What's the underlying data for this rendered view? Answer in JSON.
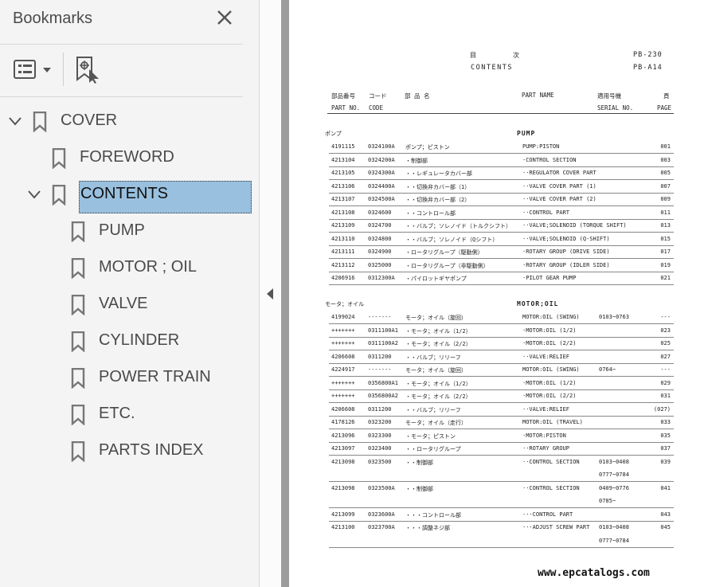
{
  "panel": {
    "title": "Bookmarks",
    "items": [
      {
        "label": "COVER"
      },
      {
        "label": "FOREWORD"
      },
      {
        "label": "CONTENTS"
      },
      {
        "label": "PUMP"
      },
      {
        "label": "MOTOR ; OIL"
      },
      {
        "label": "VALVE"
      },
      {
        "label": "CYLINDER"
      },
      {
        "label": "POWER TRAIN"
      },
      {
        "label": "ETC."
      },
      {
        "label": "PARTS INDEX"
      }
    ]
  },
  "page": {
    "title_jp": "目次",
    "title_en": "CONTENTS",
    "code1": "PB-230",
    "code2": "PB-A14",
    "headers": {
      "partno_jp": "部品番号",
      "code_jp": "コード",
      "name_jp": "部 品 名",
      "partname": "PART NAME",
      "serial_jp": "適用号機",
      "page_jp": "頁",
      "partno": "PART NO.",
      "code": "CODE",
      "serial": "SERIAL NO.",
      "page": "PAGE"
    },
    "sections": [
      {
        "jp": "ポンプ",
        "en": "PUMP",
        "rows": [
          [
            "4191115",
            "0324100A",
            "ポンプ；ピストン",
            "PUMP:PISTON",
            "",
            "001"
          ],
          [
            "4213104",
            "0324200A",
            "・制御部",
            "·CONTROL SECTION",
            "",
            "003"
          ],
          [
            "4213105",
            "0324300A",
            "・・レギュレータカバー部",
            "··REGULATOR COVER PART",
            "",
            "005"
          ],
          [
            "4213106",
            "0324400A",
            "・・切換弁カバー部（1）",
            "··VALVE COVER PART (1)",
            "",
            "007"
          ],
          [
            "4213107",
            "0324500A",
            "・・切換弁カバー部（2）",
            "··VALVE COVER PART (2)",
            "",
            "009"
          ],
          [
            "4213108",
            "0324600",
            "・・コントロール部",
            "··CONTROL PART",
            "",
            "011"
          ],
          [
            "4213109",
            "0324700",
            "・・バルブ；ソレノイド（トルクシフト）",
            "··VALVE;SOLENOID (TORQUE SHIFT)",
            "",
            "013"
          ],
          [
            "4213110",
            "0324800",
            "・・バルブ；ソレノイド（Qシフト）",
            "··VALVE;SOLENOID (Q-SHIFT)",
            "",
            "015"
          ],
          [
            "4213111",
            "0324900",
            "・ロータリグループ（駆動側）",
            "·ROTARY GROUP (DRIVE SIDE)",
            "",
            "017"
          ],
          [
            "4213112",
            "0325000",
            "・ロータリグループ（非駆動側）",
            "·ROTARY GROUP (IDLER SIDE)",
            "",
            "019"
          ],
          [
            "4206916",
            "0312300A",
            "・パイロットギヤポンプ",
            "·PILOT GEAR PUMP",
            "",
            "021"
          ]
        ]
      },
      {
        "jp": "モータ；オイル",
        "en": "MOTOR;OIL",
        "rows": [
          [
            "4199024",
            "-------",
            "モータ；オイル（旋回）",
            "MOTOR:OIL (SWING)",
            "0103~0763",
            "---"
          ],
          [
            "+++++++",
            "0311100A1",
            "・モータ；オイル（1/2）",
            "·MOTOR:OIL (1/2)",
            "",
            "023"
          ],
          [
            "+++++++",
            "0311100A2",
            "・モータ；オイル（2/2）",
            "·MOTOR:OIL (2/2)",
            "",
            "025"
          ],
          [
            "4206608",
            "0311200",
            "・・バルブ；リリーフ",
            "··VALVE:RELIEF",
            "",
            "027"
          ],
          [
            "4224917",
            "-------",
            "モータ；オイル（旋回）",
            "MOTOR:OIL (SWING)",
            "0764~",
            "---"
          ],
          [
            "+++++++",
            "0356800A1",
            "・モータ；オイル（1/2）",
            "·MOTOR:OIL (1/2)",
            "",
            "029"
          ],
          [
            "+++++++",
            "0356800A2",
            "・モータ；オイル（2/2）",
            "·MOTOR:OIL (2/2)",
            "",
            "031"
          ],
          [
            "4206608",
            "0311200",
            "・・バルブ；リリーフ",
            "··VALVE:RELIEF",
            "",
            "(027)"
          ],
          [
            "4178126",
            "0323200",
            "モータ；オイル（走行）",
            "MOTOR:OIL (TRAVEL)",
            "",
            "033"
          ],
          [
            "4213096",
            "0323300",
            "・モータ；ピストン",
            "·MOTOR:PISTON",
            "",
            "035"
          ],
          [
            "4213097",
            "0323400",
            "・・ロータリグループ",
            "··ROTARY GROUP",
            "",
            "037"
          ],
          [
            "4213098",
            "0323500",
            "・・制御部",
            "··CONTROL SECTION",
            "0103~0408",
            "039"
          ],
          [
            "",
            "",
            "",
            "",
            "0777~0784",
            ""
          ],
          [
            "4213098",
            "0323500A",
            "・・制御部",
            "··CONTROL SECTION",
            "0409~0776",
            "041"
          ],
          [
            "",
            "",
            "",
            "",
            "0785~",
            ""
          ],
          [
            "4213099",
            "0323600A",
            "・・・コントロール部",
            "···CONTROL PART",
            "",
            "043"
          ],
          [
            "4213100",
            "0323700A",
            "・・・調整ネジ部",
            "···ADJUST SCREW PART",
            "0103~0408",
            "045"
          ],
          [
            "",
            "",
            "",
            "",
            "0777~0784",
            ""
          ]
        ]
      }
    ],
    "watermark": "www.epcatalogs.com"
  }
}
